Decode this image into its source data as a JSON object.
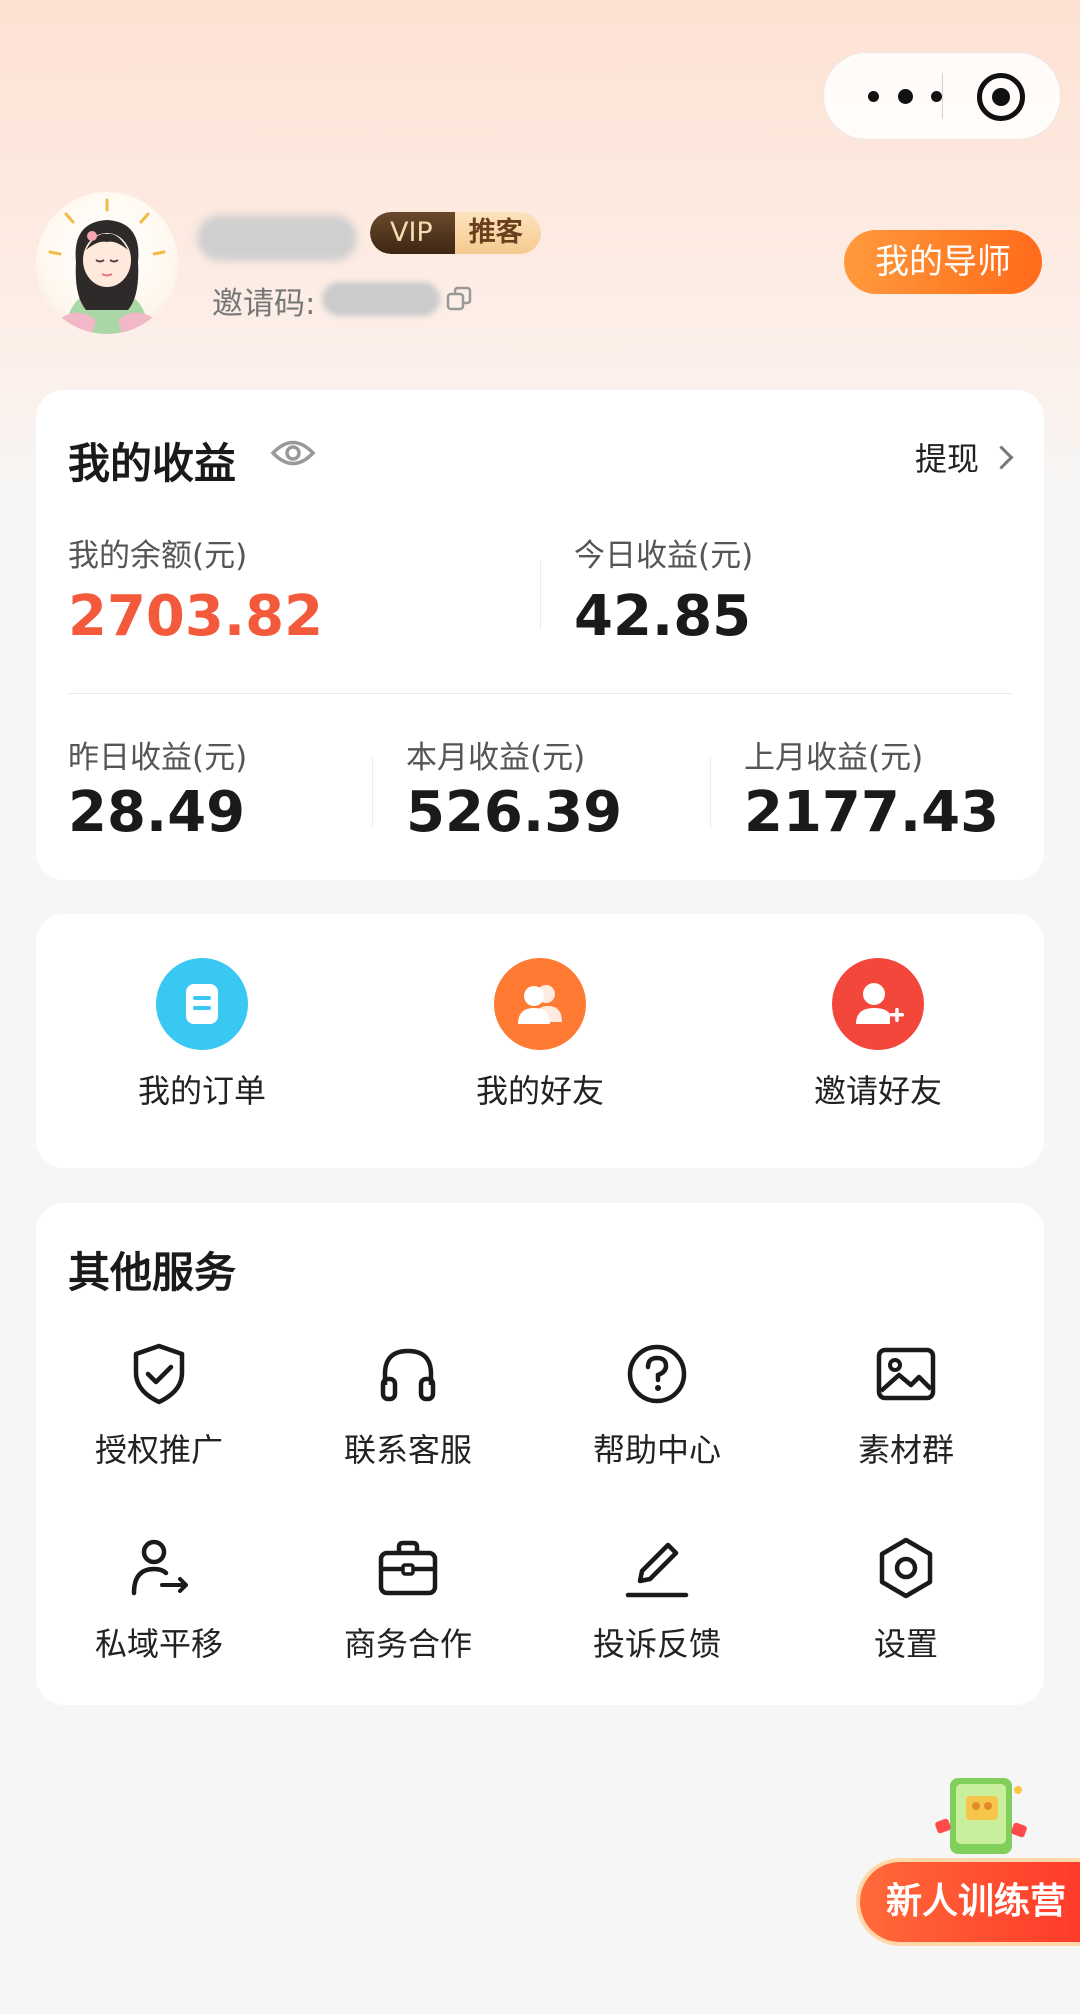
{
  "header": {
    "vip_label": "VIP",
    "role_label": "推客",
    "invite_code_label": "邀请码:",
    "mentor_button": "我的导师"
  },
  "earnings": {
    "title": "我的收益",
    "withdraw_label": "提现",
    "balance_label": "我的余额(元)",
    "balance_value": "2703.82",
    "today_label": "今日收益(元)",
    "today_value": "42.85",
    "yesterday_label": "昨日收益(元)",
    "yesterday_value": "28.49",
    "this_month_label": "本月收益(元)",
    "this_month_value": "526.39",
    "last_month_label": "上月收益(元)",
    "last_month_value": "2177.43"
  },
  "actions": [
    {
      "label": "我的订单",
      "icon": "order-icon",
      "color": "#38c8f2"
    },
    {
      "label": "我的好友",
      "icon": "friends-icon",
      "color": "#ff7a33"
    },
    {
      "label": "邀请好友",
      "icon": "invite-friend-icon",
      "color": "#f4473c"
    }
  ],
  "services": {
    "title": "其他服务",
    "items": [
      {
        "label": "授权推广",
        "icon": "shield-check-icon"
      },
      {
        "label": "联系客服",
        "icon": "headphones-icon"
      },
      {
        "label": "帮助中心",
        "icon": "help-icon"
      },
      {
        "label": "素材群",
        "icon": "image-icon"
      },
      {
        "label": "私域平移",
        "icon": "user-transfer-icon"
      },
      {
        "label": "商务合作",
        "icon": "briefcase-icon"
      },
      {
        "label": "投诉反馈",
        "icon": "edit-icon"
      },
      {
        "label": "设置",
        "icon": "settings-icon"
      }
    ]
  },
  "floating": {
    "camp_label": "新人训练营"
  },
  "colors": {
    "accent_orange": "#ff6b1a",
    "balance_red": "#f35a3c"
  }
}
